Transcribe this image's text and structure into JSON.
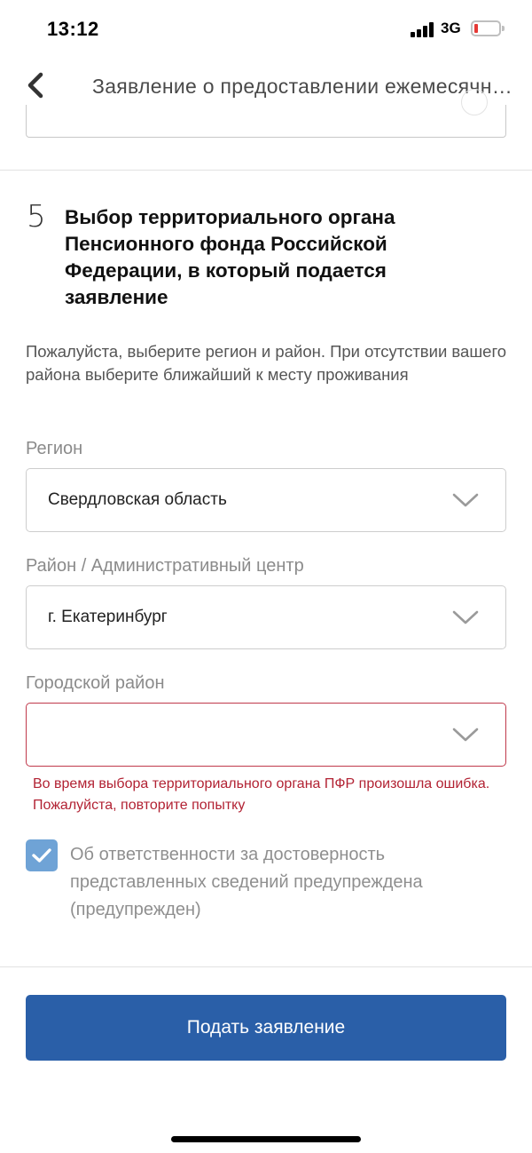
{
  "status_bar": {
    "time": "13:12",
    "network": "3G",
    "battery_level": 0.1,
    "battery_color": "#e53935"
  },
  "nav": {
    "back_icon": "chevron-left-icon",
    "title": "Заявление о предоставлении ежемесячной выплаты"
  },
  "section": {
    "number": "5",
    "title": "Выбор территориального органа Пенсионного фонда Российской Федерации, в который подается заявление",
    "hint": "Пожалуйста, выберите регион и район. При отсутствии вашего района выберите ближайший к месту проживания"
  },
  "fields": {
    "region": {
      "label": "Регион",
      "value": "Свердловская область"
    },
    "district": {
      "label": "Район / Административный центр",
      "value": "г. Екатеринбург"
    },
    "city_district": {
      "label": "Городской район",
      "value": "",
      "error": "Во время выбора территориального органа ПФР произошла ошибка. Пожалуйста, повторите попытку"
    }
  },
  "agreement": {
    "checked": true,
    "label": "Об ответственности за достоверность представленных сведений предупреждена (предупрежден)"
  },
  "submit_label": "Подать заявление",
  "colors": {
    "primary": "#2a5fa8",
    "checkbox": "#6fa3d6",
    "error": "#b22233"
  }
}
